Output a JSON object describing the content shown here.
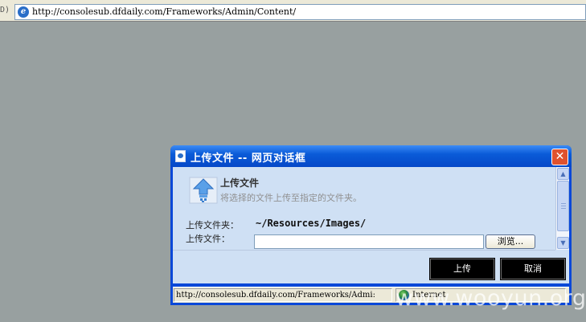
{
  "browser": {
    "left_fragment": "D)",
    "address_url": "http://consolesub.dfdaily.com/Frameworks/Admin/Content/"
  },
  "dialog": {
    "title": "上传文件 -- 网页对话框",
    "close_glyph": "✕",
    "header_title": "上传文件",
    "header_desc": "将选择的文件上传至指定的文件夹。",
    "folder_label": "上传文件夹：",
    "folder_value": "~/Resources/Images/",
    "file_label": "上传文件：",
    "file_value": "",
    "browse_label": "浏览...",
    "upload_button": "上传",
    "cancel_button": "取消",
    "status_url": "http://consolesub.dfdaily.com/Frameworks/Admi:",
    "status_zone": "Internet"
  },
  "watermark": "www.wooyun.org",
  "colors": {
    "desktop_bg": "#98a0a0",
    "titlebar_blue": "#0a5bd8",
    "client_bg": "#cfe0f4",
    "close_red": "#e0522e",
    "action_button_bg": "#000000"
  },
  "icons": [
    "ie-page-icon",
    "dialog-title-icon",
    "close-icon",
    "upload-arrow-icon",
    "scroll-up-icon",
    "scroll-down-icon",
    "globe-icon"
  ]
}
